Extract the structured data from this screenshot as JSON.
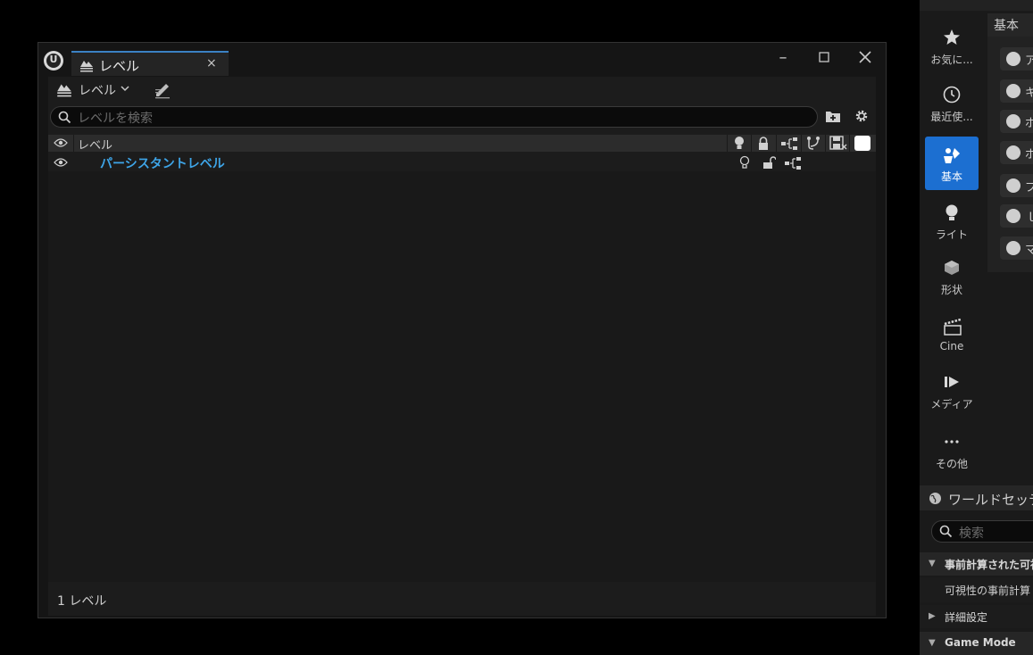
{
  "window": {
    "tab_label": "レベル",
    "tab_close": "×",
    "minimize": "–",
    "maximize": "☐",
    "close": "✕"
  },
  "toolbar": {
    "levels_menu_label": "レベル"
  },
  "search": {
    "placeholder": "レベルを検索"
  },
  "list_header": {
    "column_label": "レベル"
  },
  "levels": [
    {
      "name": "パーシスタントレベル",
      "visible": true,
      "locked": false
    }
  ],
  "footer": {
    "count_text": "1 レベル"
  },
  "place_actors": {
    "categories": [
      {
        "label": "お気に...",
        "icon": "star-icon"
      },
      {
        "label": "最近使...",
        "icon": "clock-icon"
      },
      {
        "label": "基本",
        "icon": "basic-shapes-icon",
        "active": true
      },
      {
        "label": "ライト",
        "icon": "light-bulb-icon"
      },
      {
        "label": "形状",
        "icon": "cube-icon"
      },
      {
        "label": "Cine",
        "icon": "clapper-icon"
      },
      {
        "label": "メディア",
        "icon": "media-icon"
      },
      {
        "label": "その他",
        "icon": "more-icon"
      }
    ],
    "section_title": "基本",
    "items": [
      {
        "label": "ア"
      },
      {
        "label": "キ"
      },
      {
        "label": "ポ"
      },
      {
        "label": "ポ"
      },
      {
        "label": "プ"
      },
      {
        "label": "ｌ"
      },
      {
        "label": "マ"
      }
    ]
  },
  "world_settings": {
    "title": "ワールドセッテ",
    "search_placeholder": "検索",
    "sections": [
      {
        "title": "事前計算された可視",
        "expanded": true
      },
      {
        "title": "詳細設定",
        "expanded": false
      },
      {
        "title": "Game Mode",
        "expanded": true
      }
    ],
    "property_label": "可視性の事前計算"
  },
  "colors": {
    "accent": "#1c6fd1",
    "level_name": "#3ea5e8"
  }
}
